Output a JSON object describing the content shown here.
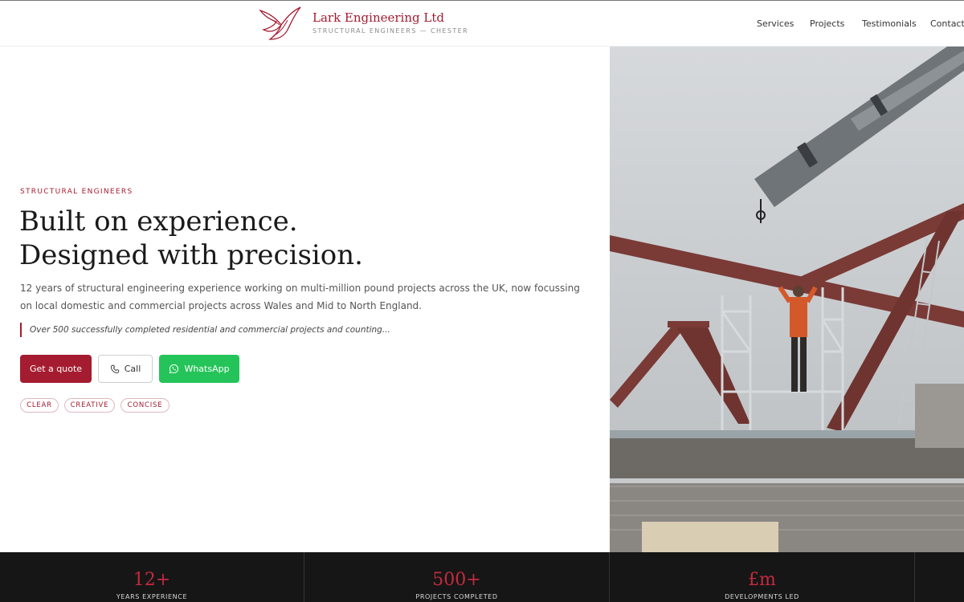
{
  "brand": {
    "name": "Lark Engineering Ltd",
    "tagline": "STRUCTURAL ENGINEERS — CHESTER",
    "accent_color": "#a51c30"
  },
  "nav": {
    "items": [
      {
        "label": "Services"
      },
      {
        "label": "Projects"
      },
      {
        "label": "Testimonials"
      },
      {
        "label": "Contact"
      }
    ]
  },
  "hero": {
    "eyebrow": "STRUCTURAL ENGINEERS",
    "headline_line1": "Built on experience.",
    "headline_line2": "Designed with precision.",
    "lead": "12 years of structural engineering experience working on multi-million pound projects across the UK, now focussing on local domestic and commercial projects across Wales and Mid to North England.",
    "quote": "Over 500 successfully completed residential and commercial projects and counting...",
    "buttons": {
      "quote_label": "Get a quote",
      "call_label": "Call",
      "whatsapp_label": "WhatsApp"
    },
    "pills": [
      "CLEAR",
      "CREATIVE",
      "CONCISE"
    ],
    "whatsapp_color": "#25c45a"
  },
  "stats": [
    {
      "value": "12+",
      "label": "YEARS EXPERIENCE"
    },
    {
      "value": "500+",
      "label": "PROJECTS COMPLETED"
    },
    {
      "value": "£m",
      "label": "DEVELOPMENTS LED"
    }
  ],
  "icons": {
    "logo": "bird-logo-icon",
    "call": "phone-icon",
    "whatsapp": "whatsapp-icon"
  }
}
